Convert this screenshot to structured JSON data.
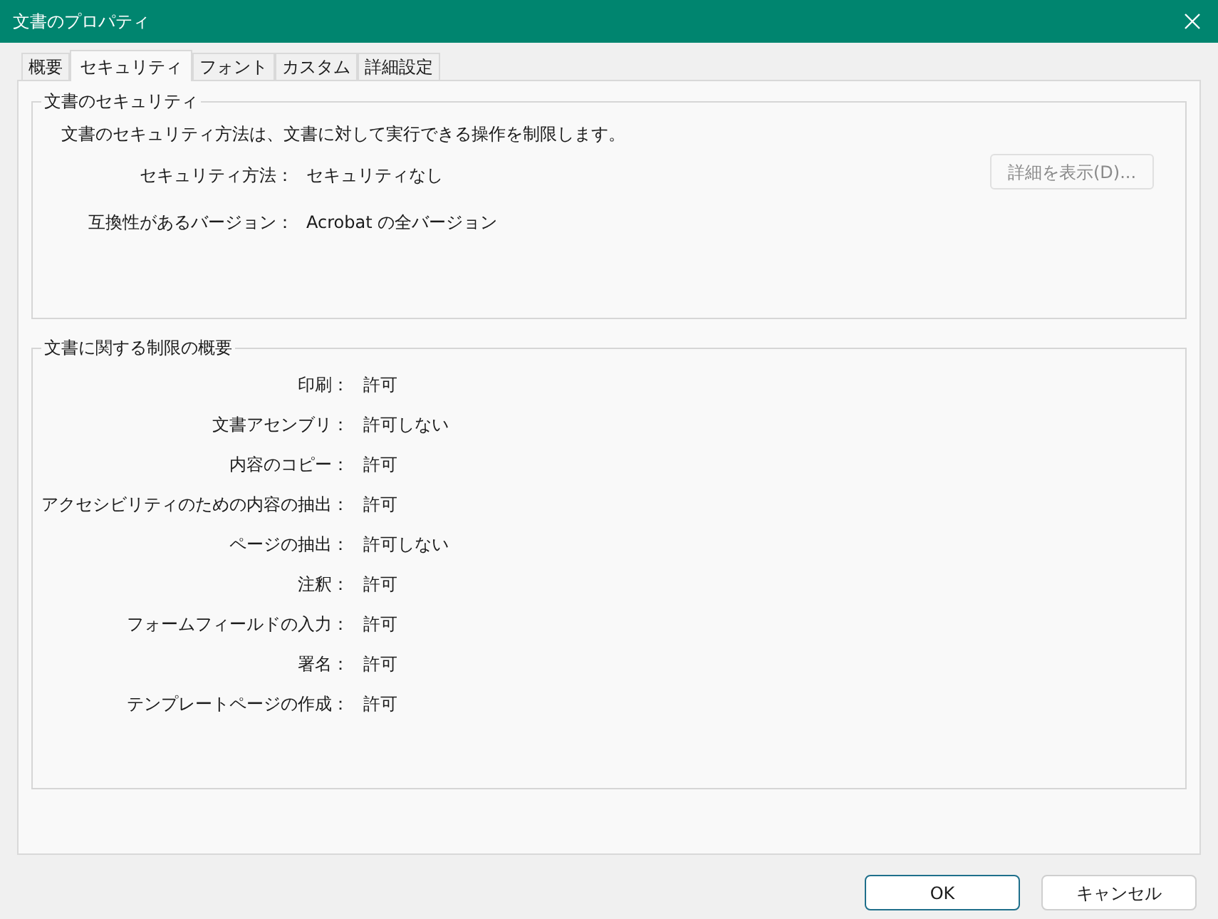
{
  "window": {
    "title": "文書のプロパティ"
  },
  "tabs": [
    {
      "label": "概要",
      "selected": false
    },
    {
      "label": "セキュリティ",
      "selected": true
    },
    {
      "label": "フォント",
      "selected": false
    },
    {
      "label": "カスタム",
      "selected": false
    },
    {
      "label": "詳細設定",
      "selected": false
    }
  ],
  "security_group": {
    "title": "文書のセキュリティ",
    "description": "文書のセキュリティ方法は、文書に対して実行できる操作を制限します。",
    "fields": [
      {
        "label": "セキュリティ方法：",
        "value": "セキュリティなし"
      },
      {
        "label": "互換性があるバージョン：",
        "value": "Acrobat の全バージョン"
      }
    ],
    "details_button": {
      "label": "詳細を表示(D)...",
      "disabled": true
    }
  },
  "restrictions_group": {
    "title": "文書に関する制限の概要",
    "rows": [
      {
        "label": "印刷：",
        "value": "許可"
      },
      {
        "label": "文書アセンブリ：",
        "value": "許可しない"
      },
      {
        "label": "内容のコピー：",
        "value": "許可"
      },
      {
        "label": "アクセシビリティのための内容の抽出：",
        "value": "許可"
      },
      {
        "label": "ページの抽出：",
        "value": "許可しない"
      },
      {
        "label": "注釈：",
        "value": "許可"
      },
      {
        "label": "フォームフィールドの入力：",
        "value": "許可"
      },
      {
        "label": "署名：",
        "value": "許可"
      },
      {
        "label": "テンプレートページの作成：",
        "value": "許可"
      }
    ]
  },
  "buttons": [
    {
      "label": "OK",
      "default": true
    },
    {
      "label": "キャンセル",
      "default": false
    }
  ]
}
